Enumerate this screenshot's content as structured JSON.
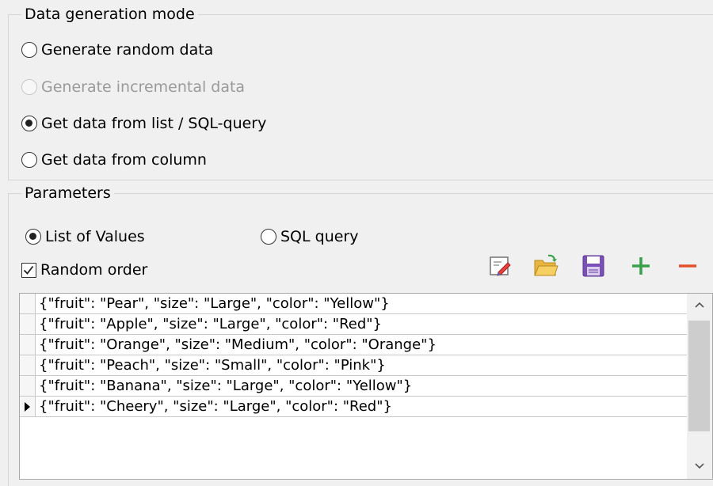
{
  "mode_group": {
    "title": "Data generation mode",
    "options": [
      {
        "label": "Generate random data",
        "checked": false,
        "disabled": false
      },
      {
        "label": "Generate incremental data",
        "checked": false,
        "disabled": true
      },
      {
        "label": "Get data from list / SQL-query",
        "checked": true,
        "disabled": false
      },
      {
        "label": "Get data from column",
        "checked": false,
        "disabled": false
      }
    ]
  },
  "params_group": {
    "title": "Parameters",
    "source_options": [
      {
        "label": "List of Values",
        "checked": true
      },
      {
        "label": "SQL query",
        "checked": false
      }
    ],
    "random_order": {
      "label": "Random order",
      "checked": true
    },
    "toolbar_icons": [
      "edit-icon",
      "open-folder-icon",
      "save-icon",
      "add-icon",
      "remove-icon"
    ]
  },
  "grid": {
    "rows": [
      "{\"fruit\": \"Pear\", \"size\": \"Large\", \"color\": \"Yellow\"}",
      "{\"fruit\": \"Apple\", \"size\": \"Large\", \"color\": \"Red\"}",
      "{\"fruit\": \"Orange\", \"size\": \"Medium\", \"color\": \"Orange\"}",
      "{\"fruit\": \"Peach\", \"size\": \"Small\", \"color\": \"Pink\"}",
      "{\"fruit\": \"Banana\", \"size\": \"Large\", \"color\": \"Yellow\"}",
      "{\"fruit\": \"Cheery\", \"size\": \"Large\", \"color\": \"Red\"}"
    ],
    "current_row_index": 5
  }
}
